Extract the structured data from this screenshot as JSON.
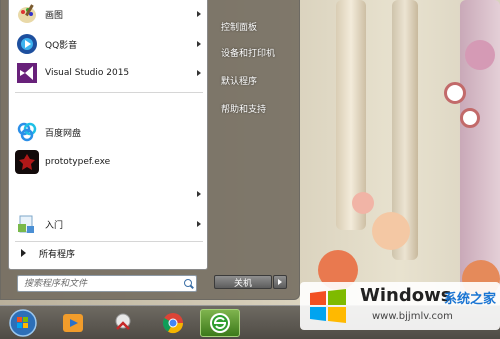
{
  "start_menu": {
    "programs": [
      {
        "label": "画图",
        "icon": "paint-icon",
        "has_submenu": true
      },
      {
        "label": "QQ影音",
        "icon": "qq-player-icon",
        "has_submenu": true
      },
      {
        "label": "Visual Studio 2015",
        "icon": "visual-studio-icon",
        "has_submenu": true
      },
      {
        "label": "百度网盘",
        "icon": "baidu-netdisk-icon",
        "has_submenu": false
      },
      {
        "label": "prototypef.exe",
        "icon": "prototype-exe-icon",
        "has_submenu": false
      },
      {
        "label": "",
        "icon": "",
        "has_submenu": true
      },
      {
        "label": "入门",
        "icon": "getting-started-icon",
        "has_submenu": true
      }
    ],
    "all_programs": "所有程序",
    "search_placeholder": "搜索程序和文件",
    "right_items": [
      "控制面板",
      "设备和打印机",
      "默认程序",
      "帮助和支持"
    ],
    "shutdown_label": "关机"
  },
  "taskbar": {
    "icons": [
      "windows-start-orb-icon",
      "media-player-icon",
      "network-tool-icon",
      "chrome-icon",
      "refresh-green-icon"
    ]
  },
  "watermark": {
    "title": "Windows",
    "cn": "系统之家",
    "url": "www.bjjmlv.com"
  }
}
